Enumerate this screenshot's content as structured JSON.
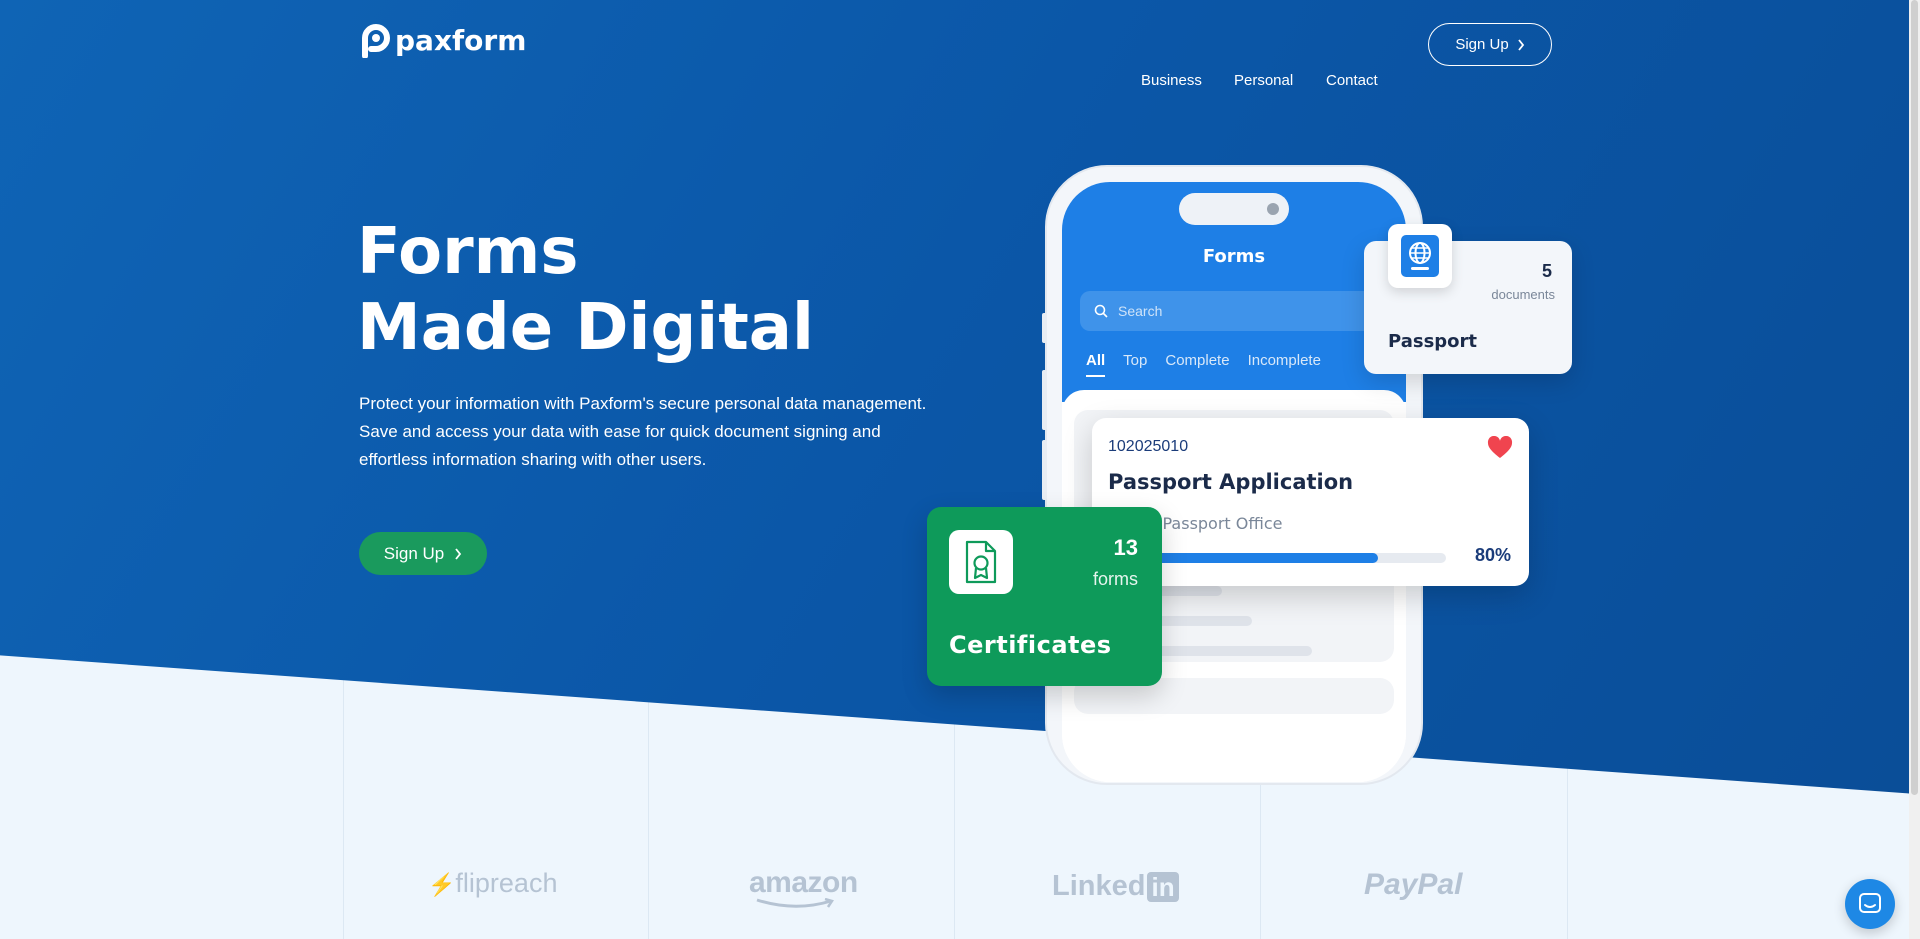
{
  "brand": {
    "name": "paxform"
  },
  "nav": {
    "links": [
      "Business",
      "Personal",
      "Contact"
    ],
    "signup_label": "Sign Up"
  },
  "hero": {
    "title_line1": "Forms",
    "title_line2": "Made Digital",
    "lead_line1": "Protect your information with Paxform's secure personal data management.",
    "lead_line2": "Save and access your data with ease for quick document signing and",
    "lead_line3": "effortless information sharing with other users.",
    "cta_label": "Sign Up"
  },
  "phone": {
    "title": "Forms",
    "search_placeholder": "Search",
    "tabs": [
      "All",
      "Top",
      "Complete",
      "Incomplete"
    ]
  },
  "passport_card": {
    "count": "5",
    "unit": "documents",
    "name": "Passport"
  },
  "application_card": {
    "id": "102025010",
    "title": "Passport Application",
    "office": "Indian Passport Office",
    "progress_percent": 80,
    "progress_label": "80%"
  },
  "certificates_card": {
    "count": "13",
    "unit": "forms",
    "name": "Certificates"
  },
  "partners": [
    "flipreach",
    "amazon",
    "Linked",
    "in",
    "PayPal"
  ],
  "colors": {
    "hero_blue": "#0b57a8",
    "accent_green": "#1a9a5d",
    "phone_blue": "#1e7fe6",
    "heart_red": "#f0444f"
  }
}
